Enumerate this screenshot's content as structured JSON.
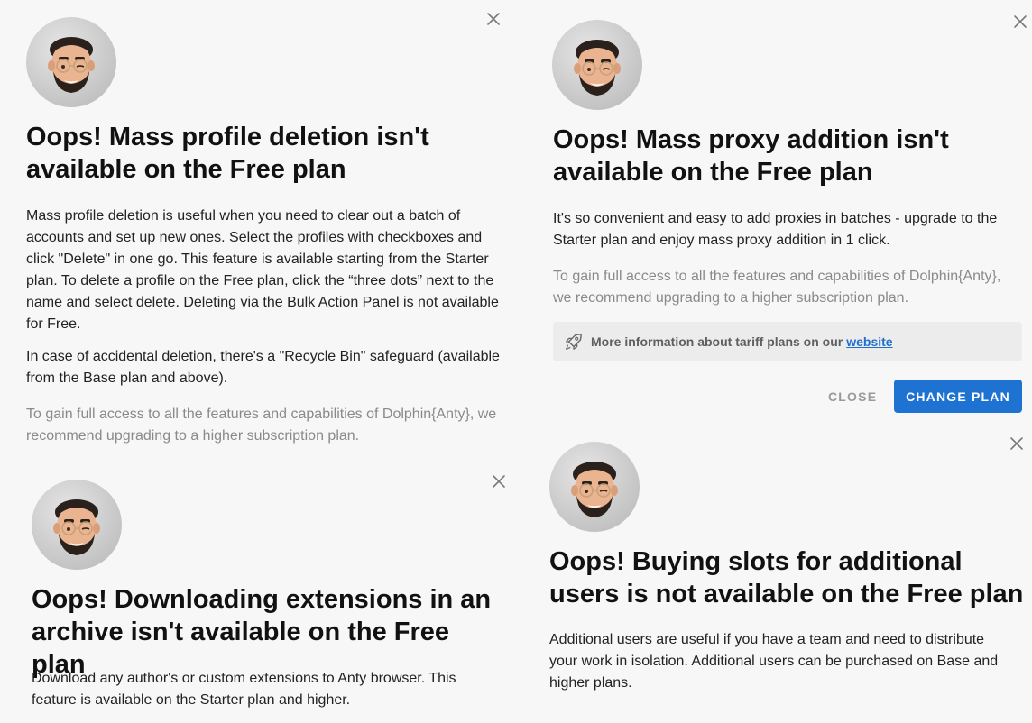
{
  "dialogs": [
    {
      "title": "Oops! Mass profile deletion isn't available on the Free plan",
      "paragraphs": [
        "Mass profile deletion is useful when you need to clear out a batch of accounts and set up new ones. Select the profiles with checkboxes and click \"Delete\" in one go. This feature is available starting from the Starter plan. To delete a profile on the Free plan, click the “three dots” next to the name and select delete. Deleting via the Bulk Action Panel is not available for Free.",
        "In case of accidental deletion, there's a \"Recycle Bin\" safeguard (available from the Base plan and above)."
      ],
      "upgrade_note": "To gain full access to all the features and capabilities of Dolphin{Anty}, we recommend upgrading to a higher subscription plan."
    },
    {
      "title": "Oops! Mass proxy addition isn't available on the Free plan",
      "paragraphs": [
        "It's so convenient and easy to add proxies in batches - upgrade to the Starter plan and enjoy mass proxy addition in 1 click."
      ],
      "upgrade_note": "To gain full access to all the features and capabilities of Dolphin{Anty}, we recommend upgrading to a higher subscription plan.",
      "info_text": "More information about tariff plans on our",
      "info_link": "website",
      "close_label": "CLOSE",
      "change_plan_label": "CHANGE PLAN"
    },
    {
      "title": "Oops! Downloading extensions in an archive isn't available on the Free plan",
      "paragraphs": [
        "Download any author's or custom extensions to Anty browser. This feature is available on the Starter plan and higher."
      ]
    },
    {
      "title": "Oops! Buying slots for additional users is not available on the Free plan",
      "paragraphs": [
        "Additional users are useful if you have a team and need to distribute your work in isolation. Additional users can be purchased on Base and higher plans."
      ]
    }
  ],
  "colors": {
    "accent": "#1e73d2",
    "muted_text": "#8a8a8a",
    "background": "#f7f7f7"
  }
}
